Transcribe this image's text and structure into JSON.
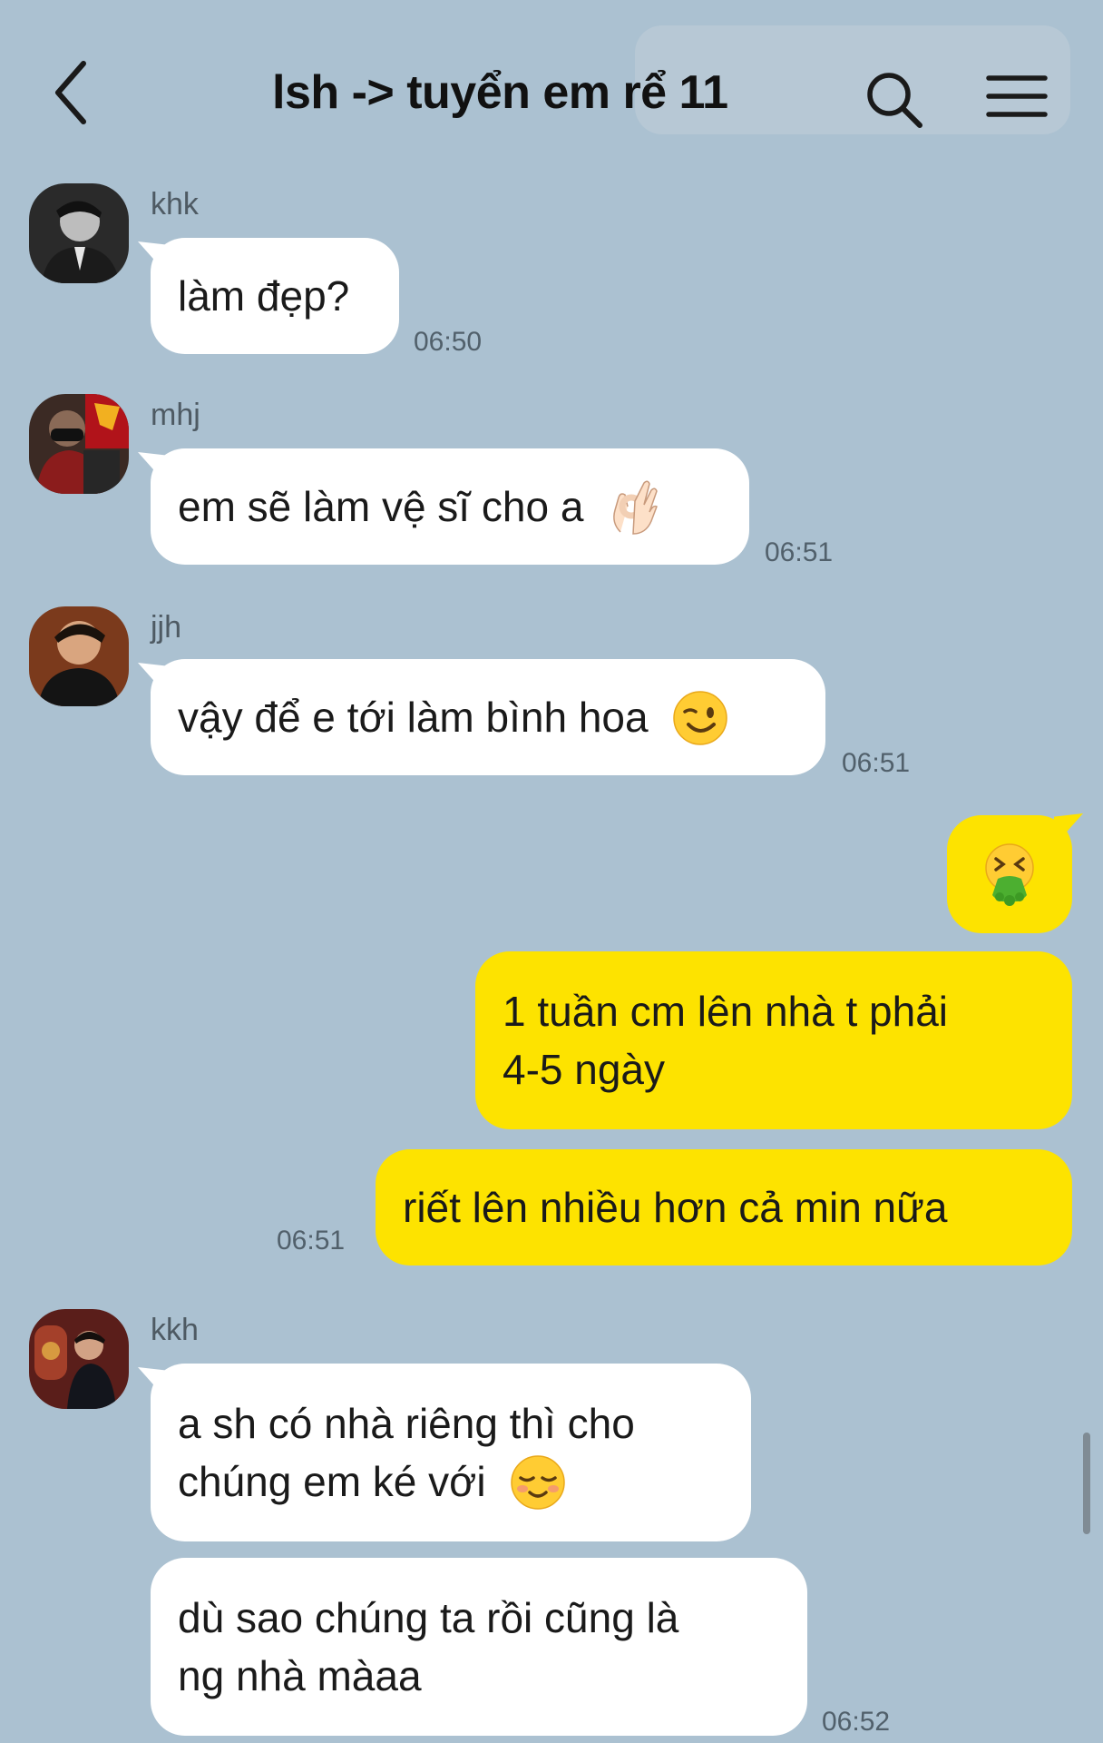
{
  "header": {
    "title": "lsh -> tuyển em rể 11"
  },
  "messages": [
    {
      "sender": "khk",
      "text": "làm đẹp?",
      "time": "06:50"
    },
    {
      "sender": "mhj",
      "text": "em sẽ làm vệ sĩ cho a",
      "emoji": "ok-hand",
      "time": "06:51"
    },
    {
      "sender": "jjh",
      "text": "vậy để e tới làm bình hoa",
      "emoji": "wink",
      "time": "06:51"
    },
    {
      "sender": "me",
      "emoji": "vomit"
    },
    {
      "sender": "me",
      "lines": [
        "1 tuần cm lên nhà t phải",
        "4-5 ngày"
      ]
    },
    {
      "sender": "me",
      "text": "riết lên nhiều hơn cả min nữa",
      "time": "06:51"
    },
    {
      "sender": "kkh",
      "lines": [
        "a sh có nhà riêng thì cho",
        "chúng em ké với"
      ],
      "emoji": "smiling"
    },
    {
      "sender": "kkh",
      "lines": [
        "dù sao chúng ta rồi cũng là",
        "ng nhà màaa"
      ],
      "time": "06:52"
    }
  ]
}
